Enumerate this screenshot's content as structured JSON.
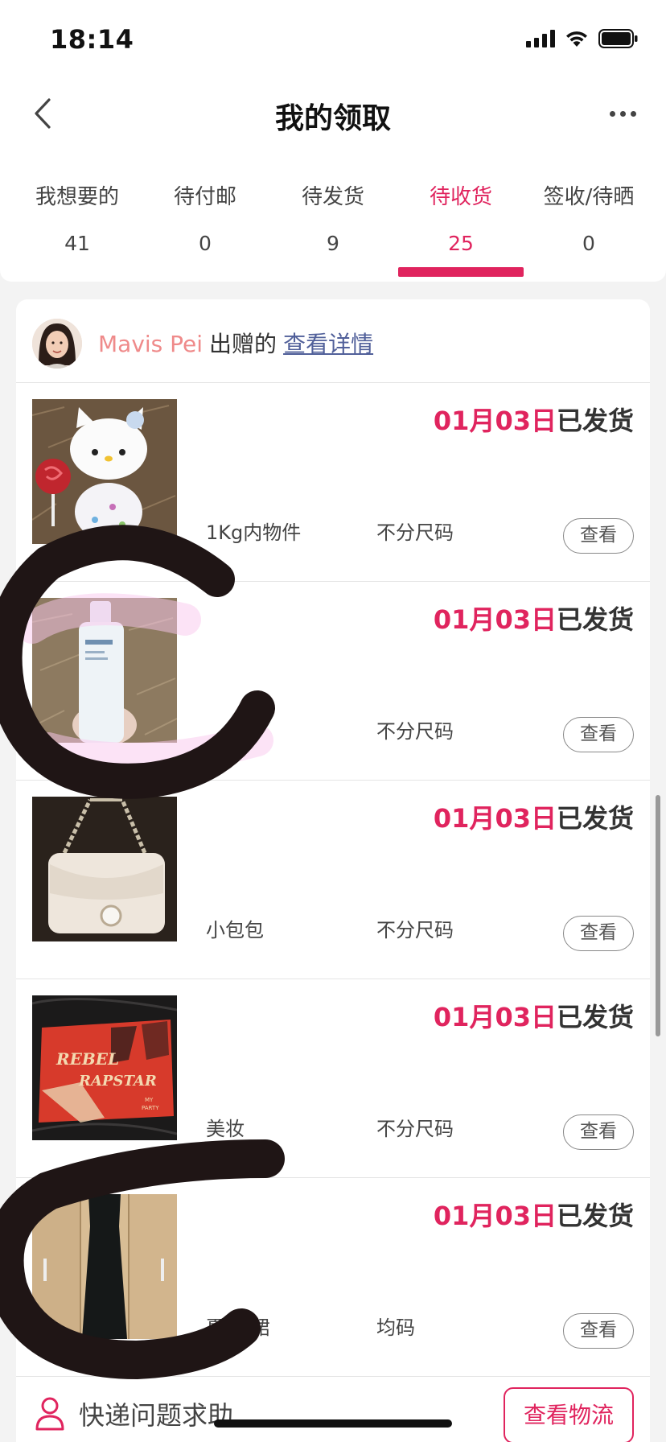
{
  "status_bar": {
    "time": "18:14"
  },
  "nav": {
    "title": "我的领取"
  },
  "tabs": [
    {
      "label": "我想要的",
      "count": "41"
    },
    {
      "label": "待付邮",
      "count": "0"
    },
    {
      "label": "待发货",
      "count": "9"
    },
    {
      "label": "待收货",
      "count": "25"
    },
    {
      "label": "签收/待晒",
      "count": "0"
    }
  ],
  "active_tab_index": 3,
  "giver": {
    "name": "Mavis Pei",
    "suffix": "出赠的",
    "details_link": "查看详情"
  },
  "items": [
    {
      "date": "01月03日",
      "status": "已发货",
      "name": "1Kg内物件",
      "size": "不分尺码",
      "view_label": "查看",
      "image": "hello-kitty-plush"
    },
    {
      "date": "01月03日",
      "status": "已发货",
      "name": "",
      "size": "不分尺码",
      "view_label": "查看",
      "image": "skincare-bottle"
    },
    {
      "date": "01月03日",
      "status": "已发货",
      "name": "小包包",
      "size": "不分尺码",
      "view_label": "查看",
      "image": "cream-handbag"
    },
    {
      "date": "01月03日",
      "status": "已发货",
      "name": "美妆",
      "size": "不分尺码",
      "view_label": "查看",
      "image": "eyeshadow-palette"
    },
    {
      "date": "01月03日",
      "status": "已发货",
      "name": "夏     衣裙",
      "size": "均码",
      "view_label": "查看",
      "image": "black-dress"
    }
  ],
  "bottom_bar": {
    "help_text": "快递问题求助",
    "logistics_button": "查看物流"
  },
  "palette_art": {
    "line1": "REBEL",
    "line2": "RAPSTAR",
    "small1": "MY",
    "small2": "PARTY"
  },
  "colors": {
    "accent": "#e0245e",
    "giver_name": "#ef8a8a",
    "link": "#51609a"
  }
}
